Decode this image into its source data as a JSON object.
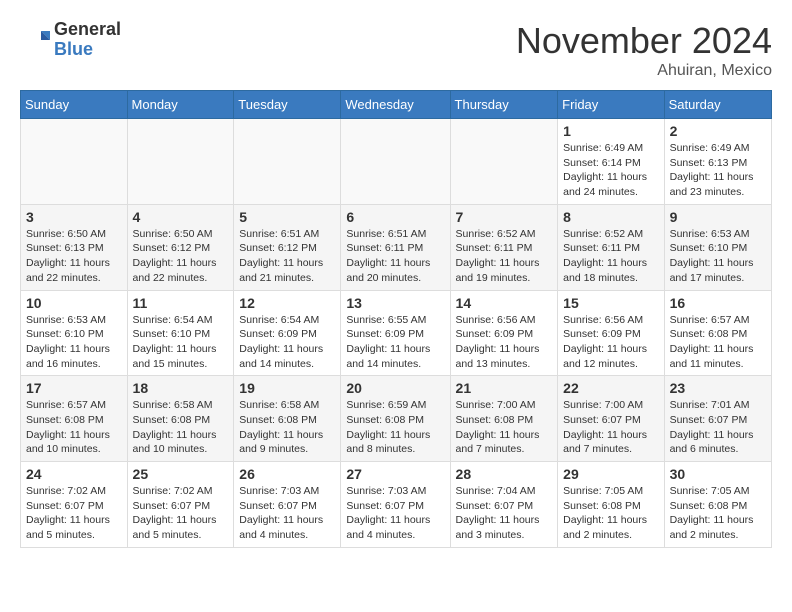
{
  "header": {
    "logo_general": "General",
    "logo_blue": "Blue",
    "month": "November 2024",
    "location": "Ahuiran, Mexico"
  },
  "weekdays": [
    "Sunday",
    "Monday",
    "Tuesday",
    "Wednesday",
    "Thursday",
    "Friday",
    "Saturday"
  ],
  "weeks": [
    [
      {
        "day": "",
        "info": ""
      },
      {
        "day": "",
        "info": ""
      },
      {
        "day": "",
        "info": ""
      },
      {
        "day": "",
        "info": ""
      },
      {
        "day": "",
        "info": ""
      },
      {
        "day": "1",
        "info": "Sunrise: 6:49 AM\nSunset: 6:14 PM\nDaylight: 11 hours and 24 minutes."
      },
      {
        "day": "2",
        "info": "Sunrise: 6:49 AM\nSunset: 6:13 PM\nDaylight: 11 hours and 23 minutes."
      }
    ],
    [
      {
        "day": "3",
        "info": "Sunrise: 6:50 AM\nSunset: 6:13 PM\nDaylight: 11 hours and 22 minutes."
      },
      {
        "day": "4",
        "info": "Sunrise: 6:50 AM\nSunset: 6:12 PM\nDaylight: 11 hours and 22 minutes."
      },
      {
        "day": "5",
        "info": "Sunrise: 6:51 AM\nSunset: 6:12 PM\nDaylight: 11 hours and 21 minutes."
      },
      {
        "day": "6",
        "info": "Sunrise: 6:51 AM\nSunset: 6:11 PM\nDaylight: 11 hours and 20 minutes."
      },
      {
        "day": "7",
        "info": "Sunrise: 6:52 AM\nSunset: 6:11 PM\nDaylight: 11 hours and 19 minutes."
      },
      {
        "day": "8",
        "info": "Sunrise: 6:52 AM\nSunset: 6:11 PM\nDaylight: 11 hours and 18 minutes."
      },
      {
        "day": "9",
        "info": "Sunrise: 6:53 AM\nSunset: 6:10 PM\nDaylight: 11 hours and 17 minutes."
      }
    ],
    [
      {
        "day": "10",
        "info": "Sunrise: 6:53 AM\nSunset: 6:10 PM\nDaylight: 11 hours and 16 minutes."
      },
      {
        "day": "11",
        "info": "Sunrise: 6:54 AM\nSunset: 6:10 PM\nDaylight: 11 hours and 15 minutes."
      },
      {
        "day": "12",
        "info": "Sunrise: 6:54 AM\nSunset: 6:09 PM\nDaylight: 11 hours and 14 minutes."
      },
      {
        "day": "13",
        "info": "Sunrise: 6:55 AM\nSunset: 6:09 PM\nDaylight: 11 hours and 14 minutes."
      },
      {
        "day": "14",
        "info": "Sunrise: 6:56 AM\nSunset: 6:09 PM\nDaylight: 11 hours and 13 minutes."
      },
      {
        "day": "15",
        "info": "Sunrise: 6:56 AM\nSunset: 6:09 PM\nDaylight: 11 hours and 12 minutes."
      },
      {
        "day": "16",
        "info": "Sunrise: 6:57 AM\nSunset: 6:08 PM\nDaylight: 11 hours and 11 minutes."
      }
    ],
    [
      {
        "day": "17",
        "info": "Sunrise: 6:57 AM\nSunset: 6:08 PM\nDaylight: 11 hours and 10 minutes."
      },
      {
        "day": "18",
        "info": "Sunrise: 6:58 AM\nSunset: 6:08 PM\nDaylight: 11 hours and 10 minutes."
      },
      {
        "day": "19",
        "info": "Sunrise: 6:58 AM\nSunset: 6:08 PM\nDaylight: 11 hours and 9 minutes."
      },
      {
        "day": "20",
        "info": "Sunrise: 6:59 AM\nSunset: 6:08 PM\nDaylight: 11 hours and 8 minutes."
      },
      {
        "day": "21",
        "info": "Sunrise: 7:00 AM\nSunset: 6:08 PM\nDaylight: 11 hours and 7 minutes."
      },
      {
        "day": "22",
        "info": "Sunrise: 7:00 AM\nSunset: 6:07 PM\nDaylight: 11 hours and 7 minutes."
      },
      {
        "day": "23",
        "info": "Sunrise: 7:01 AM\nSunset: 6:07 PM\nDaylight: 11 hours and 6 minutes."
      }
    ],
    [
      {
        "day": "24",
        "info": "Sunrise: 7:02 AM\nSunset: 6:07 PM\nDaylight: 11 hours and 5 minutes."
      },
      {
        "day": "25",
        "info": "Sunrise: 7:02 AM\nSunset: 6:07 PM\nDaylight: 11 hours and 5 minutes."
      },
      {
        "day": "26",
        "info": "Sunrise: 7:03 AM\nSunset: 6:07 PM\nDaylight: 11 hours and 4 minutes."
      },
      {
        "day": "27",
        "info": "Sunrise: 7:03 AM\nSunset: 6:07 PM\nDaylight: 11 hours and 4 minutes."
      },
      {
        "day": "28",
        "info": "Sunrise: 7:04 AM\nSunset: 6:07 PM\nDaylight: 11 hours and 3 minutes."
      },
      {
        "day": "29",
        "info": "Sunrise: 7:05 AM\nSunset: 6:08 PM\nDaylight: 11 hours and 2 minutes."
      },
      {
        "day": "30",
        "info": "Sunrise: 7:05 AM\nSunset: 6:08 PM\nDaylight: 11 hours and 2 minutes."
      }
    ]
  ]
}
